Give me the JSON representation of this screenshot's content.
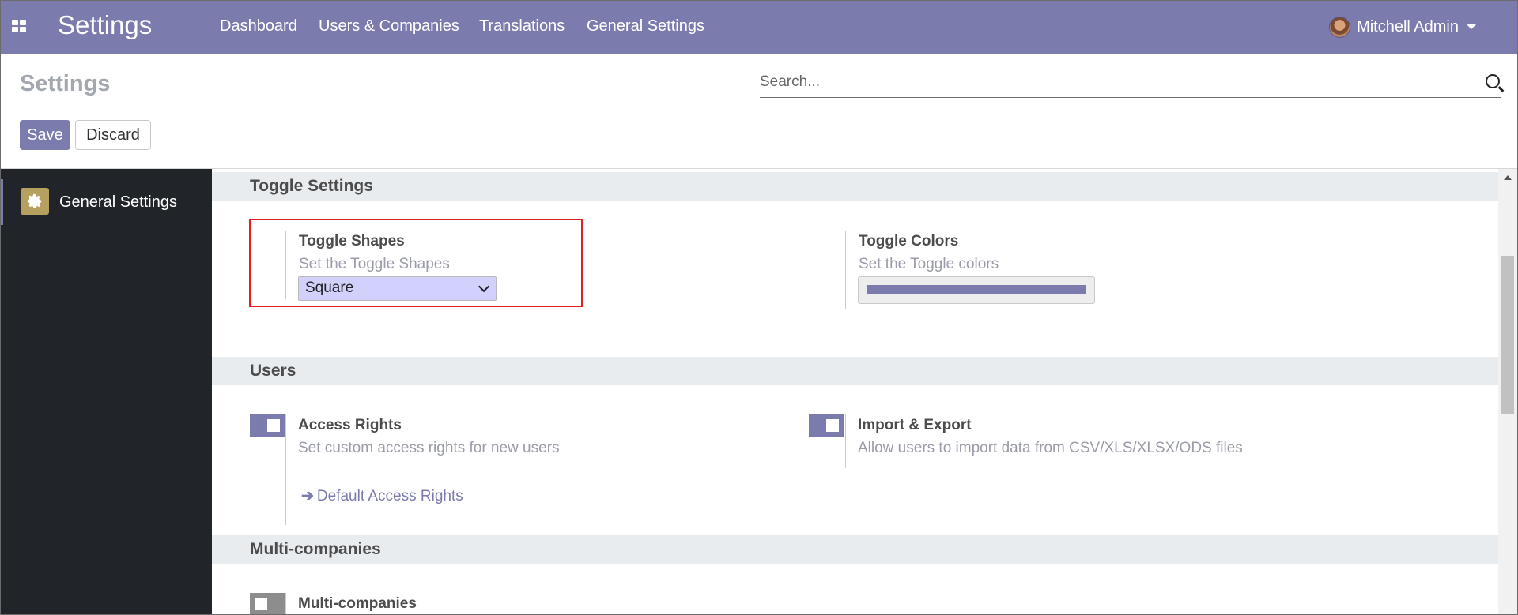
{
  "navbar": {
    "brand": "Settings",
    "items": [
      "Dashboard",
      "Users & Companies",
      "Translations",
      "General Settings"
    ],
    "user": "Mitchell Admin"
  },
  "control_panel": {
    "title": "Settings",
    "search_placeholder": "Search...",
    "save_label": "Save",
    "discard_label": "Discard"
  },
  "sidebar": {
    "items": [
      {
        "label": "General Settings",
        "icon": "gear-icon"
      }
    ]
  },
  "sections": {
    "toggle_settings": {
      "title": "Toggle Settings",
      "shapes_title": "Toggle Shapes",
      "shapes_desc": "Set the Toggle Shapes",
      "shapes_value": "Square",
      "colors_title": "Toggle Colors",
      "colors_desc": "Set the Toggle colors",
      "color_value": "#7c7bad"
    },
    "users": {
      "title": "Users",
      "access_title": "Access Rights",
      "access_desc": "Set custom access rights for new users",
      "access_link": "Default Access Rights",
      "import_title": "Import & Export",
      "import_desc": "Allow users to import data from CSV/XLS/XLSX/ODS files"
    },
    "multi": {
      "title": "Multi-companies",
      "item_title": "Multi-companies"
    }
  },
  "colors": {
    "brand": "#7c7bad",
    "sidebar": "#212529",
    "highlight": "#e02020"
  }
}
